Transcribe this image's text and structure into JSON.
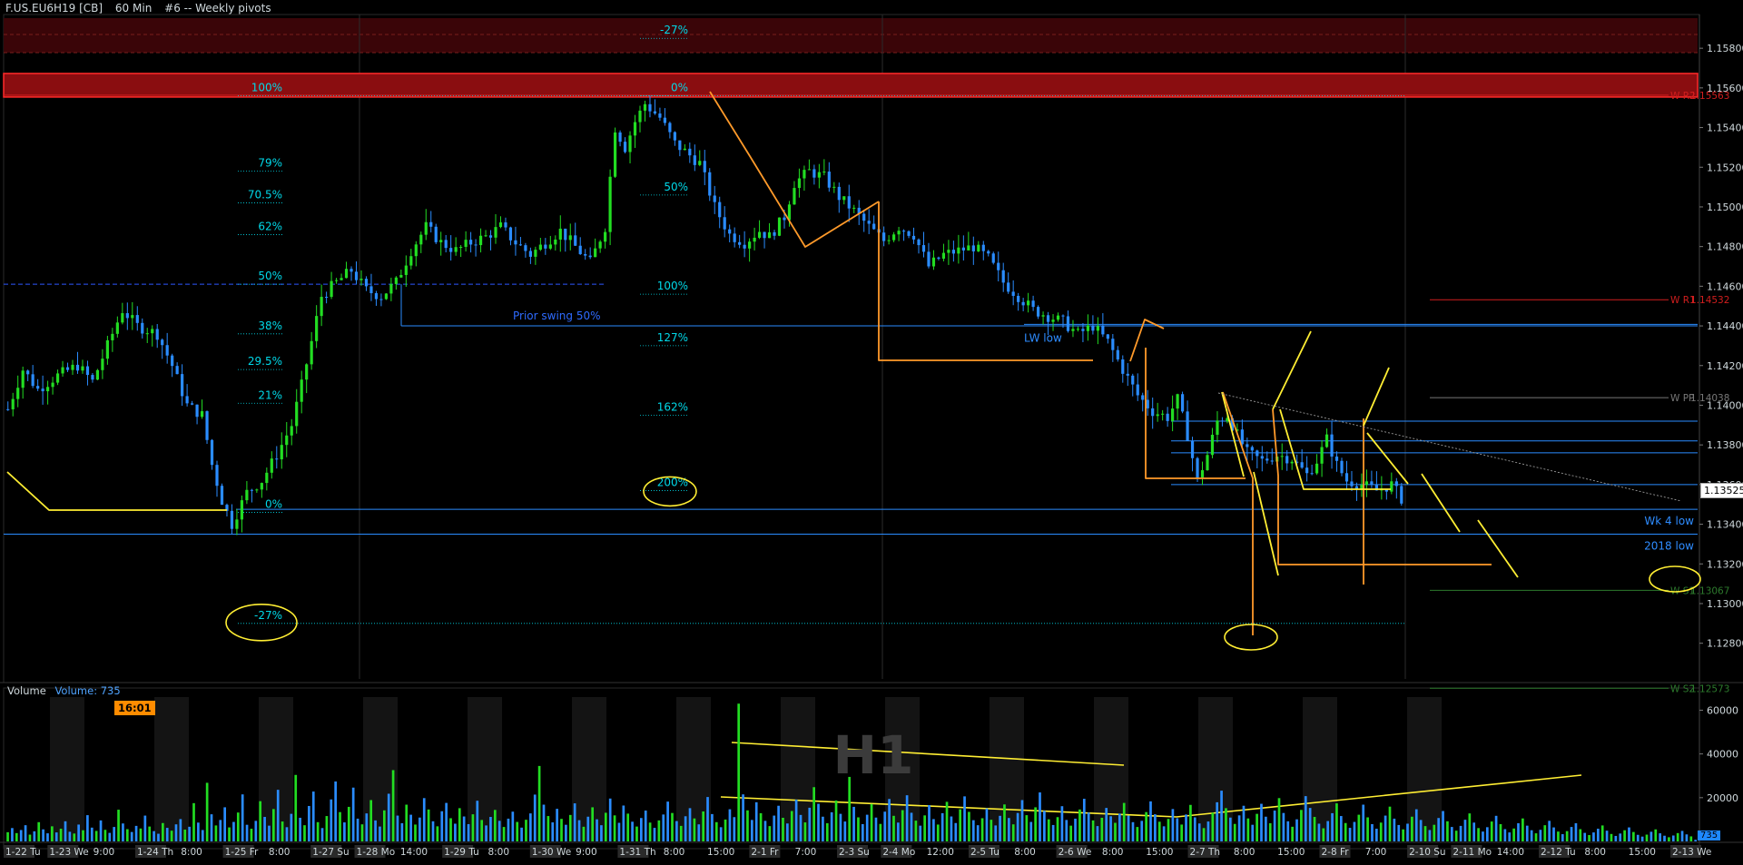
{
  "header": {
    "symbol": "F.US.EU6H19 [CB]",
    "interval": "60 Min",
    "study": "#6 -- Weekly pivots"
  },
  "volume_panel": {
    "label": "Volume",
    "value_label": "Volume: 735",
    "clock": "16:01",
    "last_volume": "735",
    "timeframe_watermark": "H1"
  },
  "last_price": "1.13525",
  "colors": {
    "background": "#000000",
    "bull_candle": "#22dd22",
    "bear_candle": "#2a8cff",
    "pivot_line": "#d21e1e",
    "level_line": "#2a8cff",
    "fib_text": "#00d8e8",
    "drawing_orange": "#ff9a2a",
    "drawing_yellow": "#ffee33"
  },
  "chart_data": [
    {
      "type": "candlestick",
      "x_ticks": [
        "1-22 Tu",
        "1-23 We",
        "9:00",
        "1-24 Th",
        "8:00",
        "1-25 Fr",
        "8:00",
        "1-27 Su",
        "1-28 Mo",
        "14:00",
        "1-29 Tu",
        "8:00",
        "1-30 We",
        "9:00",
        "1-31 Th",
        "8:00",
        "15:00",
        "2-1 Fr",
        "7:00",
        "2-3 Su",
        "2-4 Mo",
        "12:00",
        "2-5 Tu",
        "8:00",
        "2-6 We",
        "8:00",
        "15:00",
        "2-7 Th",
        "8:00",
        "15:00",
        "2-8 Fr",
        "7:00",
        "2-10 Su",
        "2-11 Mo",
        "14:00",
        "2-12 Tu",
        "8:00",
        "15:00",
        "2-13 We"
      ],
      "y_ticks": [
        "1.15800",
        "1.15600",
        "1.15400",
        "1.15200",
        "1.15000",
        "1.14800",
        "1.14600",
        "1.14400",
        "1.14200",
        "1.14000",
        "1.13800",
        "1.13600",
        "1.13400",
        "1.13200",
        "1.13000",
        "1.12800"
      ],
      "ylim": [
        1.1262,
        1.1597
      ],
      "price_path": [
        [
          0,
          1.1398
        ],
        [
          3,
          1.1418
        ],
        [
          6,
          1.1408
        ],
        [
          10,
          1.1415
        ],
        [
          14,
          1.142
        ],
        [
          17,
          1.1412
        ],
        [
          20,
          1.143
        ],
        [
          23,
          1.1448
        ],
        [
          26,
          1.144
        ],
        [
          30,
          1.1436
        ],
        [
          33,
          1.142
        ],
        [
          36,
          1.14
        ],
        [
          39,
          1.1395
        ],
        [
          41,
          1.137
        ],
        [
          43,
          1.1352
        ],
        [
          45,
          1.134
        ],
        [
          48,
          1.1356
        ],
        [
          51,
          1.1362
        ],
        [
          54,
          1.1375
        ],
        [
          57,
          1.139
        ],
        [
          59,
          1.141
        ],
        [
          61,
          1.1432
        ],
        [
          63,
          1.1455
        ],
        [
          66,
          1.1462
        ],
        [
          69,
          1.1468
        ],
        [
          72,
          1.1458
        ],
        [
          75,
          1.1455
        ],
        [
          78,
          1.1462
        ],
        [
          81,
          1.1478
        ],
        [
          84,
          1.149
        ],
        [
          87,
          1.1482
        ],
        [
          90,
          1.1478
        ],
        [
          93,
          1.1482
        ],
        [
          96,
          1.1485
        ],
        [
          99,
          1.149
        ],
        [
          102,
          1.1482
        ],
        [
          105,
          1.1476
        ],
        [
          108,
          1.1482
        ],
        [
          111,
          1.1488
        ],
        [
          114,
          1.148
        ],
        [
          117,
          1.1472
        ],
        [
          120,
          1.149
        ],
        [
          122,
          1.154
        ],
        [
          124,
          1.153
        ],
        [
          126,
          1.1543
        ],
        [
          128,
          1.1552
        ],
        [
          131,
          1.1545
        ],
        [
          134,
          1.1532
        ],
        [
          136,
          1.1528
        ],
        [
          139,
          1.1522
        ],
        [
          142,
          1.15
        ],
        [
          145,
          1.1486
        ],
        [
          148,
          1.1482
        ],
        [
          151,
          1.1488
        ],
        [
          153,
          1.1485
        ],
        [
          156,
          1.1495
        ],
        [
          158,
          1.1512
        ],
        [
          161,
          1.1518
        ],
        [
          164,
          1.1515
        ],
        [
          167,
          1.1505
        ],
        [
          170,
          1.1498
        ],
        [
          173,
          1.149
        ],
        [
          176,
          1.1483
        ],
        [
          179,
          1.149
        ],
        [
          182,
          1.1486
        ],
        [
          185,
          1.147
        ],
        [
          188,
          1.1476
        ],
        [
          191,
          1.1478
        ],
        [
          194,
          1.148
        ],
        [
          197,
          1.1474
        ],
        [
          200,
          1.1462
        ],
        [
          203,
          1.1455
        ],
        [
          206,
          1.1448
        ],
        [
          209,
          1.1445
        ],
        [
          212,
          1.1442
        ],
        [
          215,
          1.1436
        ],
        [
          218,
          1.144
        ],
        [
          221,
          1.1432
        ],
        [
          224,
          1.1418
        ],
        [
          227,
          1.1405
        ],
        [
          230,
          1.1397
        ],
        [
          233,
          1.1394
        ],
        [
          235,
          1.1403
        ],
        [
          237,
          1.1385
        ],
        [
          239,
          1.1362
        ],
        [
          241,
          1.1375
        ],
        [
          243,
          1.1392
        ],
        [
          245,
          1.1395
        ],
        [
          247,
          1.1385
        ],
        [
          249,
          1.1376
        ],
        [
          252,
          1.1372
        ],
        [
          255,
          1.1375
        ],
        [
          258,
          1.1373
        ],
        [
          261,
          1.1365
        ],
        [
          263,
          1.1372
        ],
        [
          265,
          1.1383
        ],
        [
          267,
          1.137
        ],
        [
          269,
          1.1362
        ],
        [
          272,
          1.136
        ],
        [
          275,
          1.1357
        ],
        [
          278,
          1.136
        ],
        [
          280,
          1.1353
        ]
      ],
      "bars_total": 340,
      "bars_plotted": 281,
      "weekly_pivots": [
        {
          "name": "W R2",
          "value": "1.15563",
          "price": 1.15563
        },
        {
          "name": "W R1",
          "value": "1.14532",
          "price": 1.14532
        },
        {
          "name": "W PP",
          "value": "1.14038",
          "price": 1.14038
        },
        {
          "name": "W S1",
          "value": "1.13067",
          "price": 1.13067
        },
        {
          "name": "W S2",
          "value": "1.12573",
          "price": 1.12573
        }
      ],
      "horizontal_levels": [
        {
          "label": "Prior swing 50%",
          "price": 1.144
        },
        {
          "label": "LW low",
          "price": 1.14385
        },
        {
          "label": "Wk 4 low",
          "price": 1.13475
        },
        {
          "label": "2018 low",
          "price": 1.1335
        }
      ],
      "fib_left": [
        {
          "label": "100%",
          "price": 1.1556
        },
        {
          "label": "79%",
          "price": 1.1518
        },
        {
          "label": "70.5%",
          "price": 1.1502
        },
        {
          "label": "62%",
          "price": 1.1486
        },
        {
          "label": "50%",
          "price": 1.1461
        },
        {
          "label": "38%",
          "price": 1.1436
        },
        {
          "label": "29.5%",
          "price": 1.1418
        },
        {
          "label": "21%",
          "price": 1.1401
        },
        {
          "label": "0%",
          "price": 1.1346
        },
        {
          "label": "-27%",
          "price": 1.129
        }
      ],
      "fib_mid": [
        {
          "label": "-27%",
          "price": 1.1585
        },
        {
          "label": "0%",
          "price": 1.1556
        },
        {
          "label": "50%",
          "price": 1.1506
        },
        {
          "label": "100%",
          "price": 1.1456
        },
        {
          "label": "127%",
          "price": 1.143
        },
        {
          "label": "162%",
          "price": 1.1395
        },
        {
          "label": "200%",
          "price": 1.1357
        }
      ],
      "grid": "vertical week separators",
      "legend": "none"
    },
    {
      "type": "bar",
      "name": "Volume",
      "y_ticks": [
        "60000",
        "40000",
        "20000"
      ],
      "ylim": [
        0,
        66000
      ],
      "values": [
        4200,
        6100,
        3800,
        5200,
        7400,
        3100,
        4600,
        8800,
        5500,
        3700,
        6900,
        4100,
        5800,
        9200,
        4400,
        3600,
        7700,
        5100,
        12000,
        6300,
        4800,
        9600,
        5300,
        3900,
        6600,
        14500,
        8200,
        5600,
        4300,
        7100,
        5900,
        11800,
        6800,
        4700,
        3500,
        8400,
        6200,
        4900,
        7800,
        10200,
        5400,
        6700,
        17500,
        8600,
        5200,
        26800,
        12400,
        7300,
        9800,
        15600,
        6400,
        8900,
        13200,
        21500,
        7600,
        5800,
        9400,
        18400,
        11200,
        7200,
        14800,
        23600,
        9100,
        6500,
        12600,
        30400,
        10800,
        7400,
        16200,
        22800,
        8800,
        6100,
        11600,
        19200,
        27400,
        13400,
        8700,
        15800,
        24600,
        10400,
        7800,
        12800,
        18900,
        9600,
        6800,
        14200,
        21800,
        32600,
        11800,
        8300,
        16800,
        12200,
        7700,
        10900,
        19800,
        14600,
        9200,
        6900,
        13800,
        17600,
        10600,
        8100,
        15200,
        11400,
        7900,
        12400,
        18600,
        9800,
        7300,
        11200,
        14400,
        9400,
        6600,
        10400,
        13600,
        8900,
        6300,
        9900,
        12800,
        21400,
        34500,
        16800,
        11600,
        8700,
        14900,
        10300,
        7600,
        12100,
        17400,
        9700,
        6700,
        11300,
        15600,
        10100,
        7400,
        13100,
        19600,
        11900,
        8500,
        16400,
        12700,
        9000,
        6800,
        10700,
        14100,
        8600,
        6200,
        9600,
        12300,
        18200,
        13000,
        9300,
        7100,
        11500,
        15200,
        10500,
        7800,
        13700,
        20300,
        12500,
        8800,
        6500,
        10000,
        14700,
        11100,
        63000,
        21500,
        14200,
        9800,
        17900,
        12900,
        9400,
        7000,
        11800,
        16300,
        10800,
        8200,
        13900,
        19100,
        12100,
        8700,
        15400,
        24800,
        17200,
        11300,
        8300,
        13300,
        18700,
        12600,
        9100,
        29500,
        15800,
        11000,
        7900,
        12200,
        17100,
        10900,
        8000,
        13600,
        19400,
        11700,
        8600,
        14300,
        21100,
        13100,
        9500,
        7200,
        11900,
        16600,
        10200,
        7700,
        12900,
        18100,
        11400,
        8400,
        14700,
        20600,
        13500,
        9700,
        7400,
        10600,
        15100,
        9900,
        7300,
        11700,
        16900,
        10700,
        7800,
        13000,
        18900,
        12000,
        8900,
        15600,
        22400,
        14000,
        10100,
        7500,
        11100,
        16100,
        9800,
        7200,
        10400,
        14600,
        19500,
        13200,
        9600,
        7000,
        10800,
        15300,
        11500,
        8500,
        12700,
        17600,
        11800,
        8800,
        6600,
        9400,
        13400,
        18300,
        12400,
        9000,
        6900,
        10300,
        14800,
        10600,
        7700,
        12300,
        16700,
        11000,
        8200,
        6100,
        9100,
        13100,
        17900,
        23200,
        15200,
        10900,
        8000,
        11900,
        16300,
        10500,
        7600,
        12600,
        17200,
        11300,
        8300,
        14100,
        19800,
        13000,
        9200,
        6700,
        10100,
        14400,
        20700,
        15300,
        11200,
        8100,
        6000,
        9300,
        12900,
        17400,
        11600,
        8400,
        6200,
        8900,
        12200,
        16800,
        11000,
        7900,
        5800,
        8600,
        11800,
        15900,
        10400,
        7500,
        5500,
        8100,
        11300,
        14700,
        9800,
        7000,
        5200,
        7600,
        10700,
        13900,
        9200,
        6600,
        4900,
        7100,
        9900,
        12800,
        8600,
        6100,
        4500,
        6500,
        9100,
        11700,
        7900,
        5600,
        4100,
        5900,
        8300,
        10500,
        7200,
        5100,
        3700,
        5300,
        7400,
        9400,
        6400,
        4500,
        3300,
        4700,
        6600,
        8300,
        5600,
        3900,
        2900,
        4100,
        5800,
        7300,
        4900,
        3400,
        2500,
        3600,
        5100,
        6400,
        4300,
        3000,
        2200,
        3100,
        4400,
        5500,
        3700,
        2600,
        1900,
        2700,
        3800,
        4800,
        3200,
        2300,
        735
      ],
      "legend": "none"
    }
  ]
}
